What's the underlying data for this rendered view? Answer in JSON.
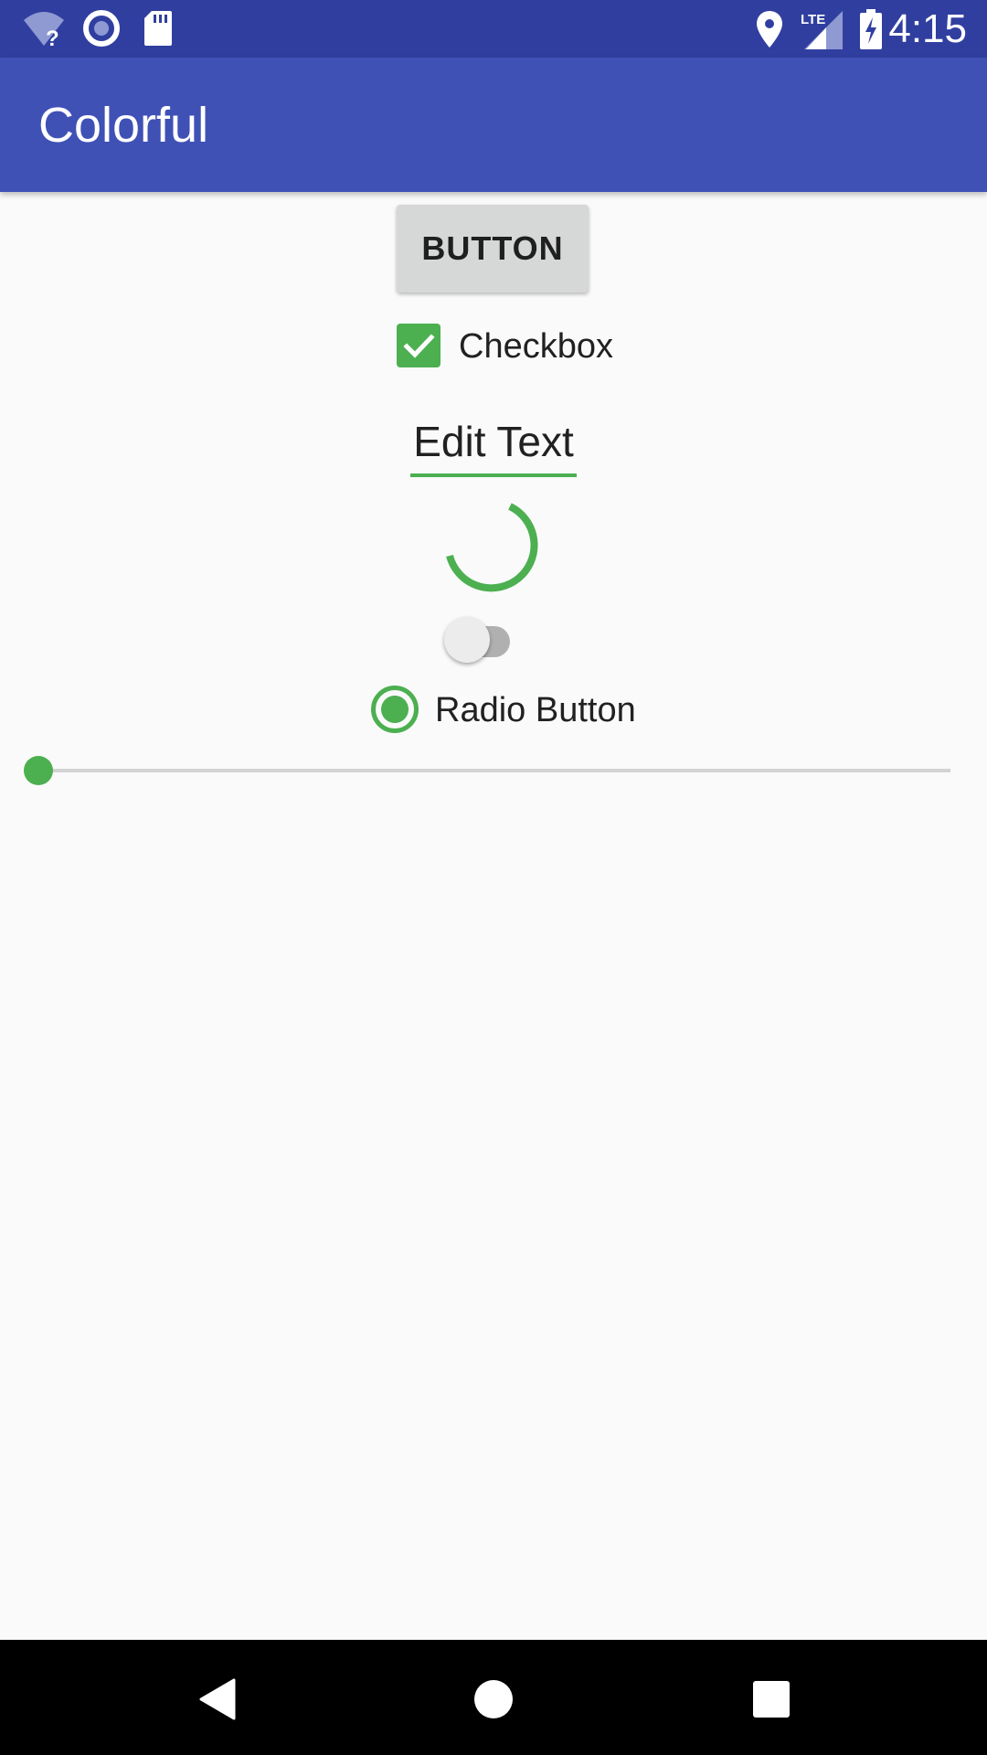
{
  "status_bar": {
    "time": "4:15",
    "icons": [
      "wifi-unknown-icon",
      "sync-icon",
      "sd-card-icon",
      "location-icon",
      "lte-signal-icon",
      "battery-charging-icon"
    ],
    "lte_label": "LTE",
    "color": "#303F9F"
  },
  "app_bar": {
    "title": "Colorful",
    "color": "#3F51B5"
  },
  "controls": {
    "button_label": "BUTTON",
    "checkbox": {
      "label": "Checkbox",
      "checked": true
    },
    "edit_text": {
      "value": "Edit Text"
    },
    "switch": {
      "on": false
    },
    "radio": {
      "label": "Radio Button",
      "selected": true
    },
    "seekbar": {
      "value": 0
    }
  },
  "nav_bar": {
    "buttons": [
      "back-icon",
      "home-icon",
      "recents-icon"
    ]
  },
  "colors": {
    "accent": "#4CAF50",
    "primary": "#3F51B5",
    "primary_dark": "#303F9F",
    "background": "#FAFAFA"
  }
}
